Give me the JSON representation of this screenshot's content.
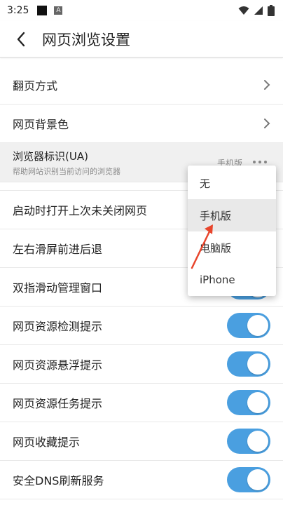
{
  "status": {
    "time": "3:25",
    "a_badge": "A"
  },
  "appbar": {
    "title": "网页浏览设置"
  },
  "rows": {
    "page_turn": "翻页方式",
    "bg_color": "网页背景色",
    "ua_label": "浏览器标识(UA)",
    "ua_sub": "帮助网站识别当前访问的浏览器",
    "ua_value": "手机版"
  },
  "toggles": [
    {
      "label": "启动时打开上次未关闭网页",
      "on": true
    },
    {
      "label": "左右滑屏前进后退",
      "on": true
    },
    {
      "label": "双指滑动管理窗口",
      "on": true
    },
    {
      "label": "网页资源检测提示",
      "on": true
    },
    {
      "label": "网页资源悬浮提示",
      "on": true
    },
    {
      "label": "网页资源任务提示",
      "on": true
    },
    {
      "label": "网页收藏提示",
      "on": true
    },
    {
      "label": "安全DNS刷新服务",
      "on": true
    }
  ],
  "popup": {
    "options": [
      "无",
      "手机版",
      "电脑版",
      "iPhone"
    ],
    "selected_index": 1
  },
  "colors": {
    "accent": "#4a9fe0",
    "arrow": "#e8452c"
  }
}
